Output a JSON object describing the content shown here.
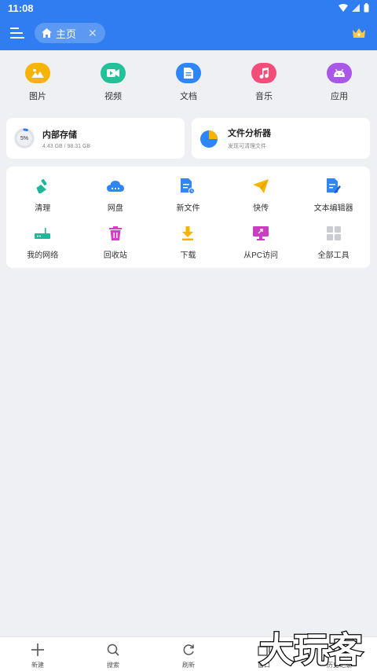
{
  "status": {
    "time": "11:08"
  },
  "appbar": {
    "tab_label": "主页"
  },
  "categories": [
    {
      "label": "图片",
      "color": "#f5b400"
    },
    {
      "label": "视频",
      "color": "#22c19a"
    },
    {
      "label": "文档",
      "color": "#2f86f6"
    },
    {
      "label": "音乐",
      "color": "#f54d7a"
    },
    {
      "label": "应用",
      "color": "#a857e6"
    }
  ],
  "storage": {
    "title": "内部存储",
    "detail": "4.43 GB / 98.31 GB",
    "percent_label": "5%",
    "used_fraction": 0.05
  },
  "analyzer": {
    "title": "文件分析器",
    "subtitle": "发现可清理文件"
  },
  "tools": [
    {
      "label": "清理",
      "icon": "broom-icon"
    },
    {
      "label": "网盘",
      "icon": "cloud-icon"
    },
    {
      "label": "新文件",
      "icon": "new-file-icon"
    },
    {
      "label": "快传",
      "icon": "paper-plane-icon"
    },
    {
      "label": "文本编辑器",
      "icon": "text-editor-icon"
    },
    {
      "label": "我的网络",
      "icon": "router-icon"
    },
    {
      "label": "回收站",
      "icon": "trash-icon"
    },
    {
      "label": "下载",
      "icon": "download-icon"
    },
    {
      "label": "从PC访问",
      "icon": "pc-access-icon"
    },
    {
      "label": "全部工具",
      "icon": "grid-icon"
    }
  ],
  "bottom_nav": [
    {
      "label": "新建",
      "icon": "plus-icon"
    },
    {
      "label": "搜索",
      "icon": "search-icon"
    },
    {
      "label": "刷新",
      "icon": "refresh-icon"
    },
    {
      "label": "窗口",
      "icon": "windows-icon"
    },
    {
      "label": "历史记录",
      "icon": "history-icon"
    }
  ],
  "watermark": {
    "text": "大玩客"
  }
}
